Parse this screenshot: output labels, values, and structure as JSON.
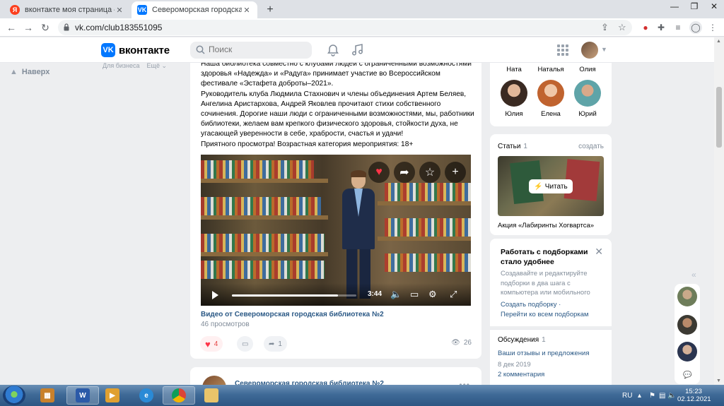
{
  "browser": {
    "tabs": [
      {
        "title": "вконтакте моя страница — Янд",
        "favicon": "yandex-icon"
      },
      {
        "title": "Североморская городская библ",
        "favicon": "vk-icon"
      }
    ],
    "url": "vk.com/club183551095"
  },
  "vk_header": {
    "logo_text": "вконтакте",
    "search_placeholder": "Поиск"
  },
  "left_nav": {
    "up_label": "Наверх"
  },
  "top_links": {
    "business": "Для бизнеса",
    "more": "Ещё"
  },
  "post": {
    "paragraphs": [
      "Наша библиотека совместно с клубами людей с ограниченными возможностями здоровья «Надежда» и «Радуга» принимает участие во Всероссийском фестивале «Эстафета доброты–2021».",
      "Руководитель клуба Людмила Стахнович и члены объединения Артем Беляев, Ангелина Аристархова, Андрей Яковлев прочитают стихи собственного сочинения. Дорогие наши люди с ограниченными возможностями, мы, работники библиотеки, желаем вам крепкого физического здоровья, стойкости духа, не угасающей уверенности в себе, храбрости, счастья и удачи!",
      "Приятного просмотра! Возрастная категория мероприятия: 18+"
    ],
    "video": {
      "duration": "3:44",
      "progress": 0.85,
      "title": "Видео от Североморская городская библиотека №2",
      "views": "46 просмотров"
    },
    "likes": "4",
    "shares": "1",
    "view_count": "26"
  },
  "next_post": {
    "author": "Североморская городская библиотека №2"
  },
  "members": {
    "row1_names": [
      "Ната",
      "Наталья",
      "Олия"
    ],
    "row2_names": [
      "Юлия",
      "Елена",
      "Юрий"
    ]
  },
  "articles": {
    "heading": "Статьи",
    "count": "1",
    "create": "создать",
    "read_button": "Читать",
    "caption": "Акция «Лабиринты Хогвартса»"
  },
  "promo": {
    "heading": "Работать с подборками стало удобнее",
    "text": "Создавайте и редактируйте подборки в два шага с компьютера или мобильного",
    "link1": "Создать подборку ·",
    "link2": "Перейти ко всем подборкам"
  },
  "discussions": {
    "heading": "Обсуждения",
    "count": "1",
    "topic": "Ваши отзывы и предложения",
    "date": "8 дек 2019",
    "comments": "2 комментария"
  },
  "taskbar": {
    "language": "RU",
    "time": "15:23",
    "date": "02.12.2021"
  },
  "colors": {
    "vk_blue": "#0077ff",
    "link": "#2a5885",
    "like": "#ff3347"
  }
}
